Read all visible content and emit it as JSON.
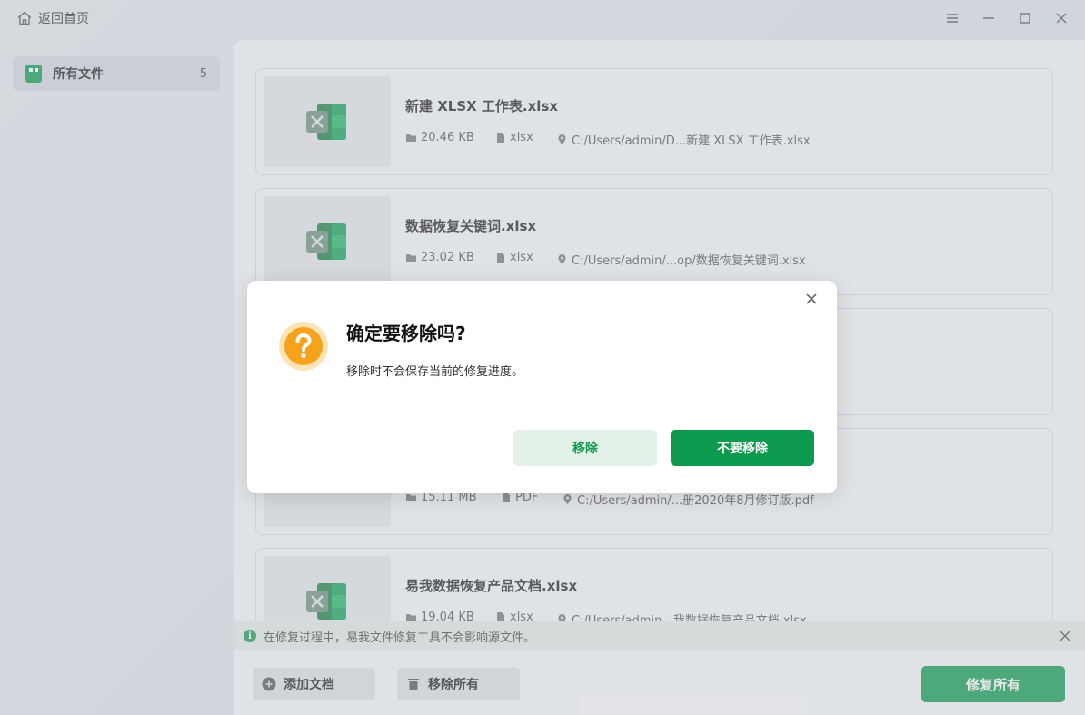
{
  "titlebar": {
    "back_label": "返回首页",
    "controls": [
      "menu-icon",
      "minimize-icon",
      "maximize-icon",
      "close-icon"
    ]
  },
  "sidebar": {
    "items": [
      {
        "label": "所有文件",
        "count": "5",
        "icon": "file-list-icon"
      }
    ]
  },
  "files": [
    {
      "name": "新建 XLSX 工作表.xlsx",
      "size": "20.46 KB",
      "type": "xlsx",
      "path": "C:/Users/admin/D...新建 XLSX 工作表.xlsx",
      "icon": "excel-icon"
    },
    {
      "name": "数据恢复关键词.xlsx",
      "size": "23.02 KB",
      "type": "xlsx",
      "path": "C:/Users/admin/...op/数据恢复关键词.xlsx",
      "icon": "excel-icon"
    },
    {
      "name": "",
      "size": "",
      "type": "",
      "path": "",
      "icon": "excel-icon"
    },
    {
      "name": "",
      "size": "15.11 MB",
      "type": "PDF",
      "path": "C:/Users/admin/...册2020年8月修订版.pdf",
      "icon": "pdf-icon"
    },
    {
      "name": "易我数据恢复产品文档.xlsx",
      "size": "19.04 KB",
      "type": "xlsx",
      "path": "C:/Users/admin...我数据恢复产品文档.xlsx",
      "icon": "excel-icon"
    }
  ],
  "info_bar": {
    "text": "在修复过程中，易我文件修复工具不会影响源文件。"
  },
  "bottom": {
    "add_label": "添加文档",
    "remove_all_label": "移除所有",
    "repair_all_label": "修复所有"
  },
  "dialog": {
    "title": "确定要移除吗?",
    "message": "移除时不会保存当前的修复进度。",
    "confirm_label": "移除",
    "cancel_label": "不要移除"
  },
  "colors": {
    "accent": "#129a52",
    "warning": "#f7a21b",
    "pdf": "#e04a4a"
  }
}
